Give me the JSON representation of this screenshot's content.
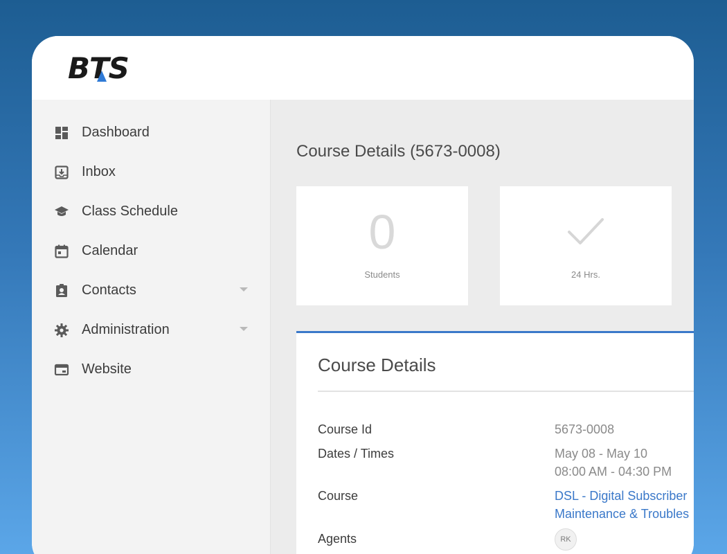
{
  "brand": {
    "logo_text": "BTS",
    "logo_accent_color": "#2f7ad6"
  },
  "sidebar": {
    "items": [
      {
        "label": "Dashboard",
        "icon": "dashboard-icon"
      },
      {
        "label": "Inbox",
        "icon": "inbox-icon"
      },
      {
        "label": "Class Schedule",
        "icon": "graduation-cap-icon"
      },
      {
        "label": "Calendar",
        "icon": "calendar-icon"
      },
      {
        "label": "Contacts",
        "icon": "contact-card-icon",
        "has_submenu": true
      },
      {
        "label": "Administration",
        "icon": "gear-icon",
        "has_submenu": true
      },
      {
        "label": "Website",
        "icon": "browser-window-icon"
      }
    ]
  },
  "main": {
    "page_title": "Course Details (5673-0008)",
    "stats": [
      {
        "value": "0",
        "label": "Students"
      },
      {
        "icon": "checkmark-icon",
        "label": "24 Hrs."
      }
    ],
    "details": {
      "title": "Course Details",
      "accent_color": "#3a78c9",
      "fields": {
        "course_id_label": "Course Id",
        "course_id_value": "5673-0008",
        "dates_label": "Dates / Times",
        "dates_value": "May 08 - May 10",
        "times_value": "08:00 AM - 04:30 PM",
        "course_label": "Course",
        "course_link_line1": "DSL - Digital Subscriber",
        "course_link_line2": "Maintenance & Troubles",
        "agents_label": "Agents",
        "agent_initials": "RK"
      }
    }
  }
}
